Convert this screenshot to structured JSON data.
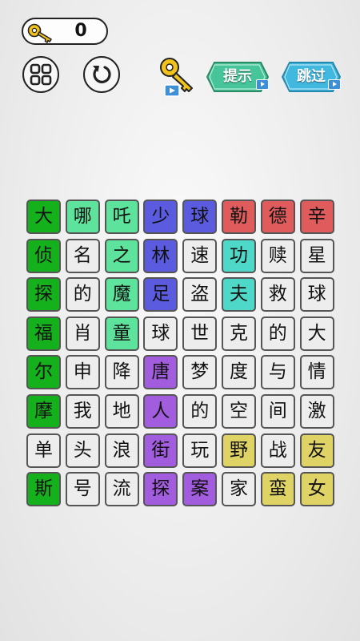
{
  "keys": {
    "count": "0"
  },
  "buttons": {
    "hint_label": "提示",
    "skip_label": "跳过"
  },
  "icons": {
    "key": "key-icon",
    "menu": "grid-menu-icon",
    "restart": "restart-icon",
    "hint_key": "hint-key-icon",
    "video": "video-icon"
  },
  "colors": {
    "G": "#14b11c",
    "L": "#5ee39c",
    "B": "#5b5bdf",
    "R": "#e05c5c",
    "T": "#4dd8c8",
    "P": "#a25ddf",
    "Y": "#e0d366",
    "N": "#ededed",
    "hint_button": "#46c59a",
    "skip_button": "#40b8e0"
  },
  "grid": {
    "rows": [
      {
        "chars": [
          "大",
          "哪",
          "吒",
          "少",
          "球",
          "勒",
          "德",
          "辛"
        ],
        "colors": [
          "G",
          "L",
          "L",
          "B",
          "B",
          "R",
          "R",
          "R"
        ]
      },
      {
        "chars": [
          "侦",
          "名",
          "之",
          "林",
          "速",
          "功",
          "赎",
          "星"
        ],
        "colors": [
          "G",
          "N",
          "L",
          "B",
          "N",
          "T",
          "N",
          "N"
        ]
      },
      {
        "chars": [
          "探",
          "的",
          "魔",
          "足",
          "盗",
          "夫",
          "救",
          "球"
        ],
        "colors": [
          "G",
          "N",
          "L",
          "B",
          "N",
          "T",
          "N",
          "N"
        ]
      },
      {
        "chars": [
          "福",
          "肖",
          "童",
          "球",
          "世",
          "克",
          "的",
          "大"
        ],
        "colors": [
          "G",
          "N",
          "L",
          "N",
          "N",
          "N",
          "N",
          "N"
        ]
      },
      {
        "chars": [
          "尔",
          "申",
          "降",
          "唐",
          "梦",
          "度",
          "与",
          "情"
        ],
        "colors": [
          "G",
          "N",
          "N",
          "P",
          "N",
          "N",
          "N",
          "N"
        ]
      },
      {
        "chars": [
          "摩",
          "我",
          "地",
          "人",
          "的",
          "空",
          "间",
          "激"
        ],
        "colors": [
          "G",
          "N",
          "N",
          "P",
          "N",
          "N",
          "N",
          "N"
        ]
      },
      {
        "chars": [
          "单",
          "头",
          "浪",
          "街",
          "玩",
          "野",
          "战",
          "友"
        ],
        "colors": [
          "N",
          "N",
          "N",
          "P",
          "N",
          "Y",
          "N",
          "Y"
        ]
      },
      {
        "chars": [
          "斯",
          "号",
          "流",
          "探",
          "案",
          "家",
          "蛮",
          "女"
        ],
        "colors": [
          "G",
          "N",
          "N",
          "P",
          "P",
          "N",
          "Y",
          "Y"
        ]
      }
    ]
  }
}
